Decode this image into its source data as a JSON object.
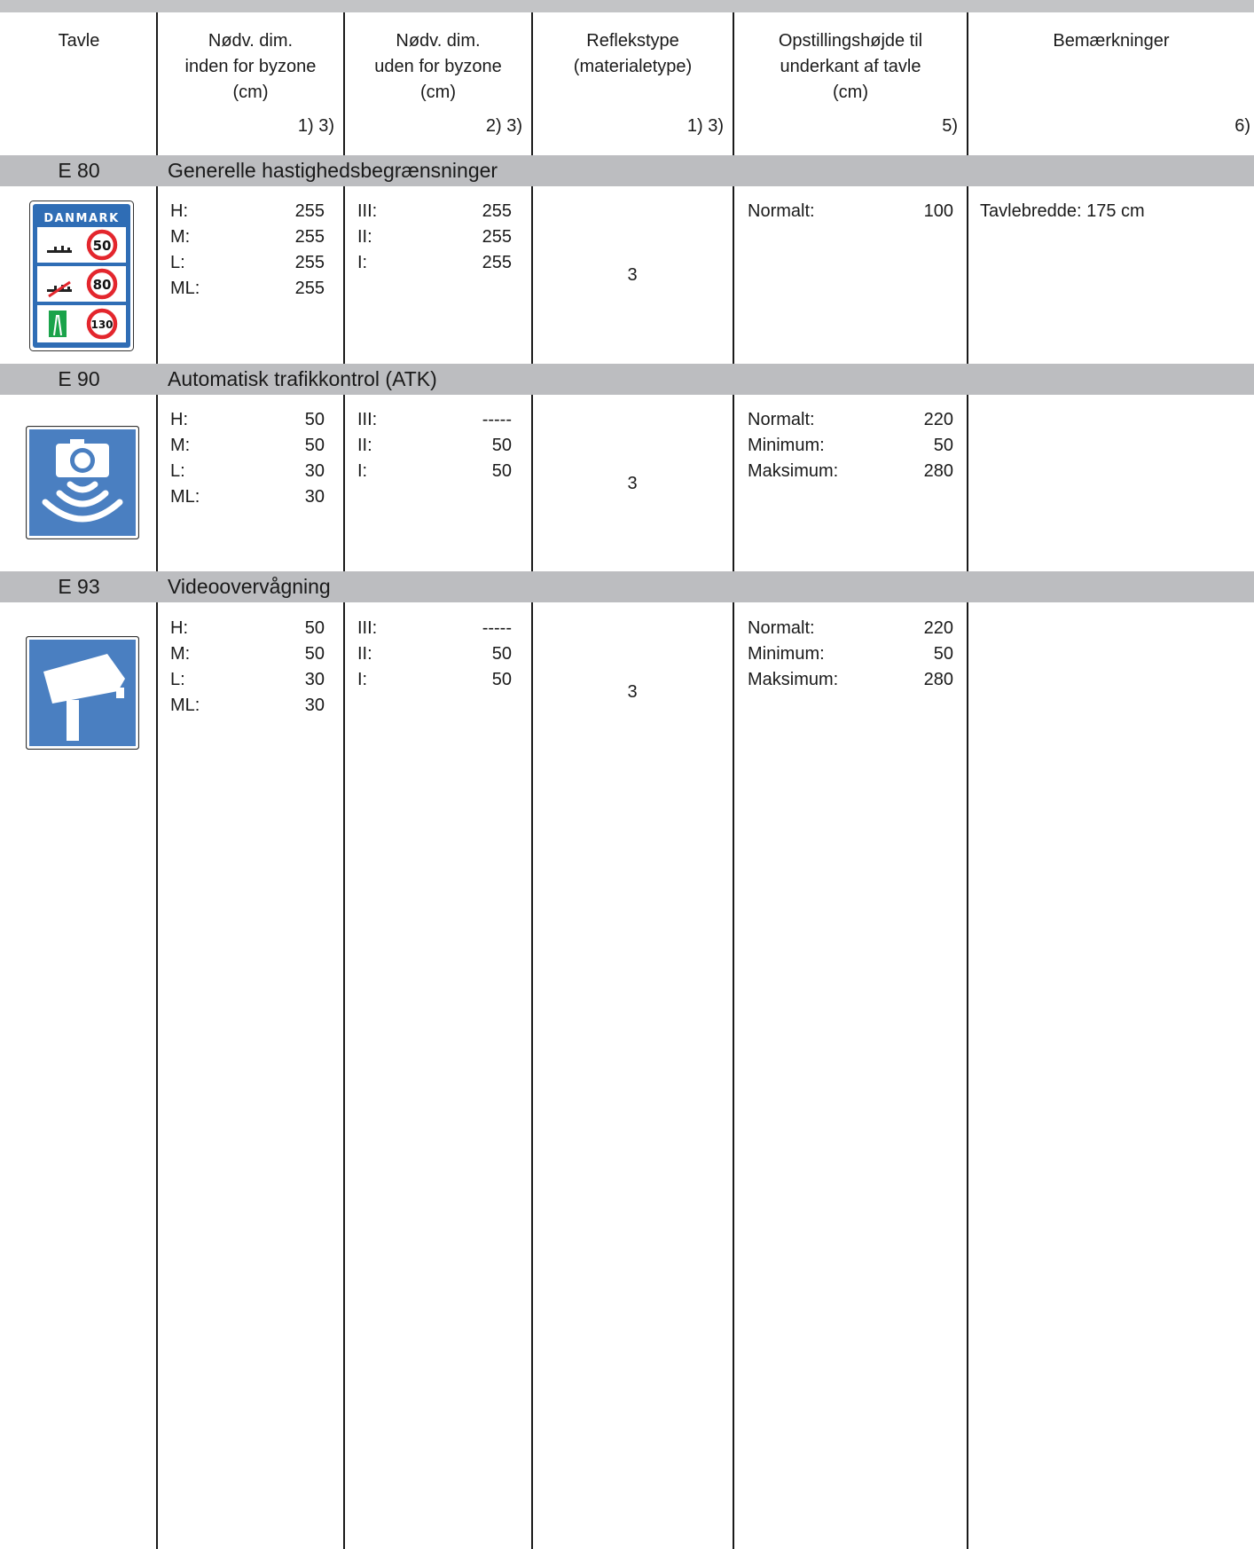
{
  "columns": {
    "tavle": "Tavle",
    "inden": [
      "Nødv. dim.",
      "inden for byzone",
      "(cm)"
    ],
    "inden_fn": "1) 3)",
    "uden": [
      "Nødv. dim.",
      "uden for byzone",
      "(cm)"
    ],
    "uden_fn": "2) 3)",
    "reflex": [
      "Reflekstype",
      "(materialetype)"
    ],
    "reflex_fn": "1) 3)",
    "height": [
      "Opstillingshøjde til",
      "underkant af tavle",
      "(cm)"
    ],
    "height_fn": "5)",
    "remarks": "Bemærkninger",
    "remarks_fn": "6)"
  },
  "rows": [
    {
      "code": "E 80",
      "title": "Generelle hastighedsbegrænsninger",
      "inden": [
        [
          "H:",
          "255"
        ],
        [
          "M:",
          "255"
        ],
        [
          "L:",
          "255"
        ],
        [
          "ML:",
          "255"
        ]
      ],
      "uden": [
        [
          "III:",
          "255"
        ],
        [
          "II:",
          "255"
        ],
        [
          "I:",
          "255"
        ]
      ],
      "reflex": "3",
      "height": [
        [
          "Normalt:",
          "100"
        ]
      ],
      "remark": "Tavlebredde: 175 cm",
      "sign": {
        "icon": "speed-limits-country-sign-icon",
        "country": "DANMARK",
        "limits": [
          "50",
          "80",
          "130"
        ],
        "blue": "#2f6db5",
        "green": "#1aa34a",
        "red": "#e3262d"
      }
    },
    {
      "code": "E 90",
      "title": "Automatisk trafikkontrol (ATK)",
      "inden": [
        [
          "H:",
          "50"
        ],
        [
          "M:",
          "50"
        ],
        [
          "L:",
          "30"
        ],
        [
          "ML:",
          "30"
        ]
      ],
      "uden": [
        [
          "III:",
          "-----"
        ],
        [
          "II:",
          "50"
        ],
        [
          "I:",
          "50"
        ]
      ],
      "reflex": "3",
      "height": [
        [
          "Normalt:",
          "220"
        ],
        [
          "Minimum:",
          "50"
        ],
        [
          "Maksimum:",
          "280"
        ]
      ],
      "remark": "",
      "sign": {
        "icon": "speed-camera-sign-icon",
        "blue": "#4a7fc1"
      }
    },
    {
      "code": "E 93",
      "title": "Videoovervågning",
      "inden": [
        [
          "H:",
          "50"
        ],
        [
          "M:",
          "50"
        ],
        [
          "L:",
          "30"
        ],
        [
          "ML:",
          "30"
        ]
      ],
      "uden": [
        [
          "III:",
          "-----"
        ],
        [
          "II:",
          "50"
        ],
        [
          "I:",
          "50"
        ]
      ],
      "reflex": "3",
      "height": [
        [
          "Normalt:",
          "220"
        ],
        [
          "Minimum:",
          "50"
        ],
        [
          "Maksimum:",
          "280"
        ]
      ],
      "remark": "",
      "sign": {
        "icon": "video-surveillance-sign-icon",
        "blue": "#4a7fc1"
      }
    }
  ]
}
